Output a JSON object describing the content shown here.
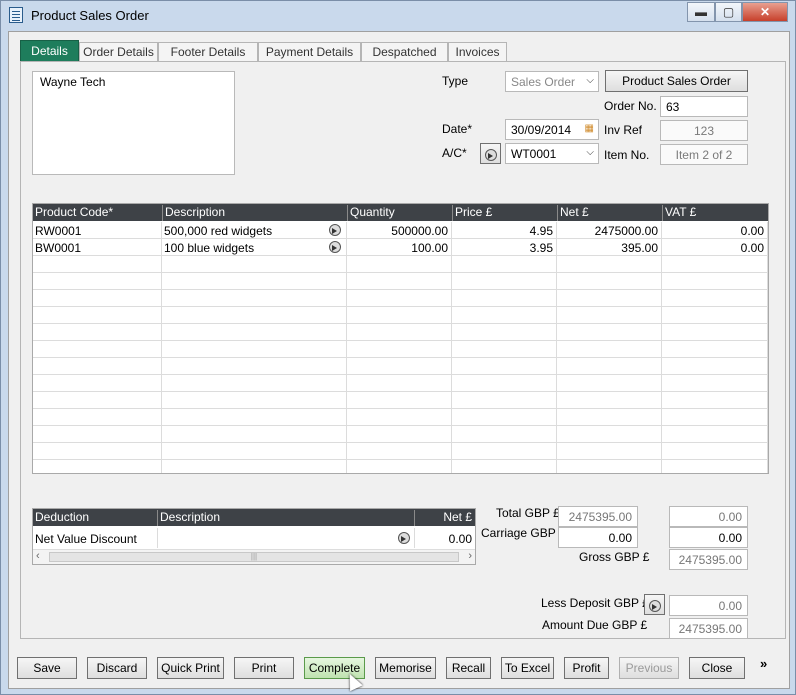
{
  "window": {
    "title": "Product Sales Order",
    "controls": {
      "minimize": "▬",
      "maximize": "▢",
      "close": "✕"
    }
  },
  "tabs": [
    "Details",
    "Order Details",
    "Footer Details",
    "Payment Details",
    "Despatched",
    "Invoices"
  ],
  "customer_address": "Wayne Tech",
  "header": {
    "type_label": "Type",
    "type_value": "Sales Order",
    "product_sales_order_button": "Product Sales Order",
    "order_no_label": "Order No.",
    "order_no": "63",
    "date_label": "Date*",
    "date": "30/09/2014",
    "inv_ref_label": "Inv Ref",
    "inv_ref": "123",
    "ac_label": "A/C*",
    "ac_value": "WT0001",
    "item_no_label": "Item No.",
    "item_no": "Item 2 of 2"
  },
  "items_grid": {
    "columns": [
      "Product Code*",
      "Description",
      "Quantity",
      "Price £",
      "Net £",
      "VAT £"
    ],
    "rows": [
      {
        "code": "RW0001",
        "description": "500,000 red widgets",
        "quantity": "500000.00",
        "price": "4.95",
        "net": "2475000.00",
        "vat": "0.00"
      },
      {
        "code": "BW0001",
        "description": "100 blue widgets",
        "quantity": "100.00",
        "price": "3.95",
        "net": "395.00",
        "vat": "0.00"
      }
    ]
  },
  "deductions": {
    "columns": [
      "Deduction",
      "Description",
      "Net £"
    ],
    "rows": [
      {
        "deduction": "Net Value Discount",
        "description": "",
        "net": "0.00"
      }
    ]
  },
  "totals": {
    "total_label": "Total GBP £",
    "total_net": "2475395.00",
    "total_vat": "0.00",
    "carriage_label": "Carriage GBP £",
    "carriage_net": "0.00",
    "carriage_vat": "0.00",
    "gross_label": "Gross GBP £",
    "gross": "2475395.00",
    "less_deposit_label": "Less Deposit GBP £",
    "less_deposit": "0.00",
    "amount_due_label": "Amount Due GBP £",
    "amount_due": "2475395.00"
  },
  "buttons": {
    "save": "Save",
    "discard": "Discard",
    "quick_print": "Quick Print",
    "print": "Print",
    "complete": "Complete",
    "memorise": "Memorise",
    "recall": "Recall",
    "to_excel": "To Excel",
    "profit": "Profit",
    "previous": "Previous",
    "close": "Close",
    "more": "»"
  }
}
